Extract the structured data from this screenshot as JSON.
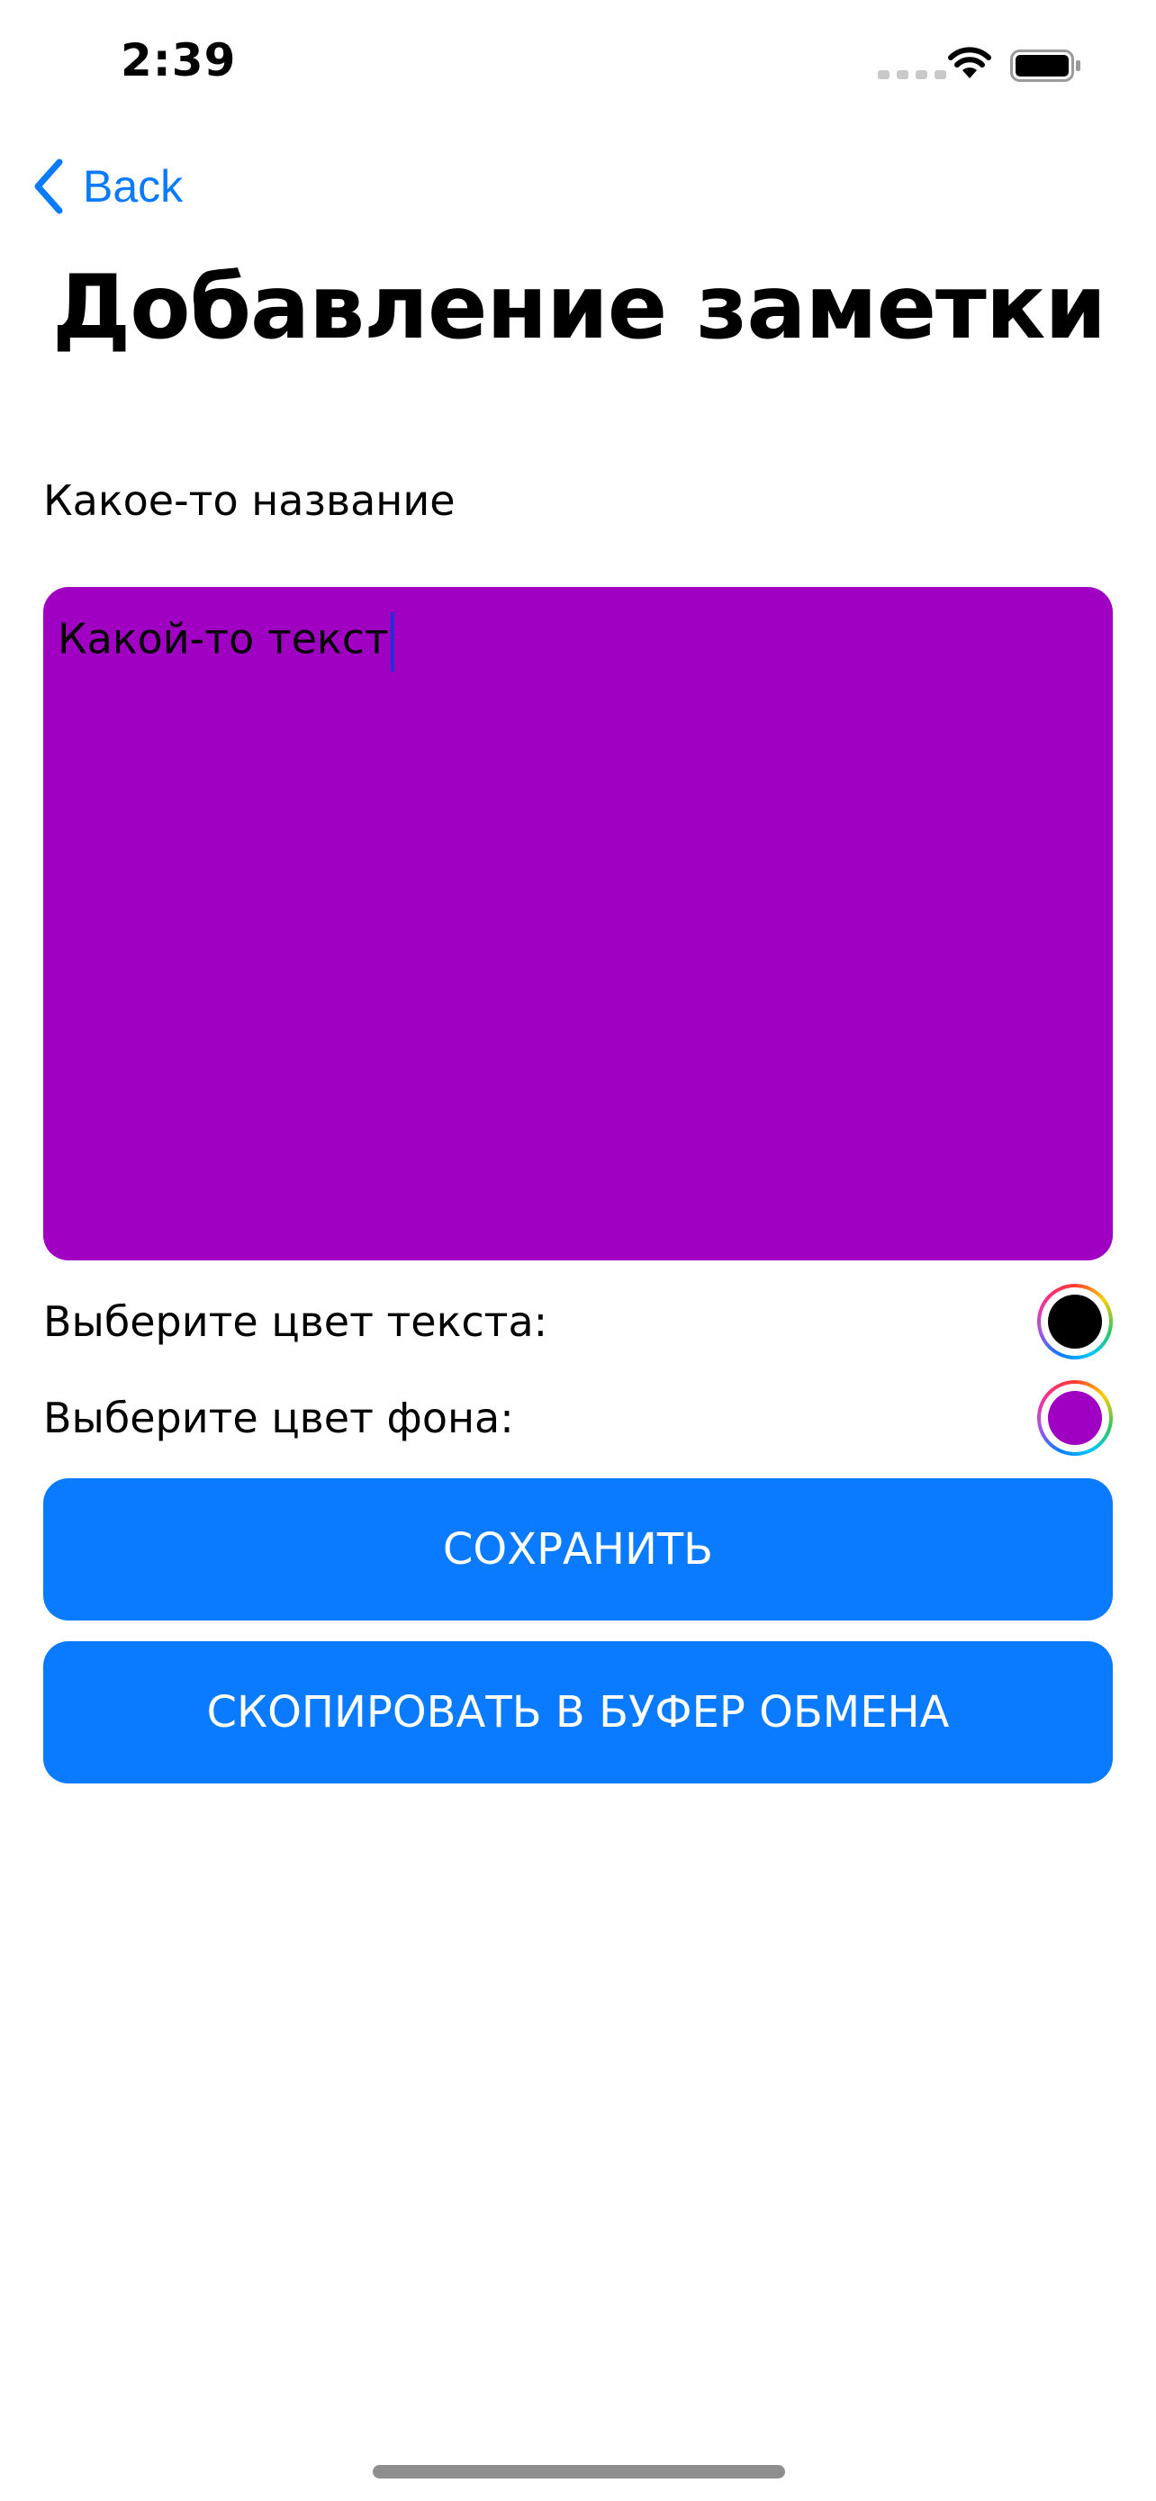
{
  "status_bar": {
    "time": "2:39",
    "icons": [
      "cellular-signal-icon",
      "wifi-icon",
      "battery-icon"
    ]
  },
  "nav": {
    "back_label": "Back",
    "back_icon": "chevron-left-icon",
    "title": "Добавление заметки"
  },
  "form": {
    "name_value": "Какое-то название",
    "body_text": "Какой-то текст",
    "text_color_label": "Выберите цвет текста:",
    "text_color": "#000000",
    "bg_color_label": "Выберите цвет фона:",
    "bg_color": "#a000c2"
  },
  "buttons": {
    "save_label": "СОХРАНИТЬ",
    "copy_label": "СКОПИРОВАТЬ В БУФЕР ОБМЕНА"
  },
  "colors": {
    "accent": "#0a7bff",
    "note_background": "#a000c2"
  }
}
